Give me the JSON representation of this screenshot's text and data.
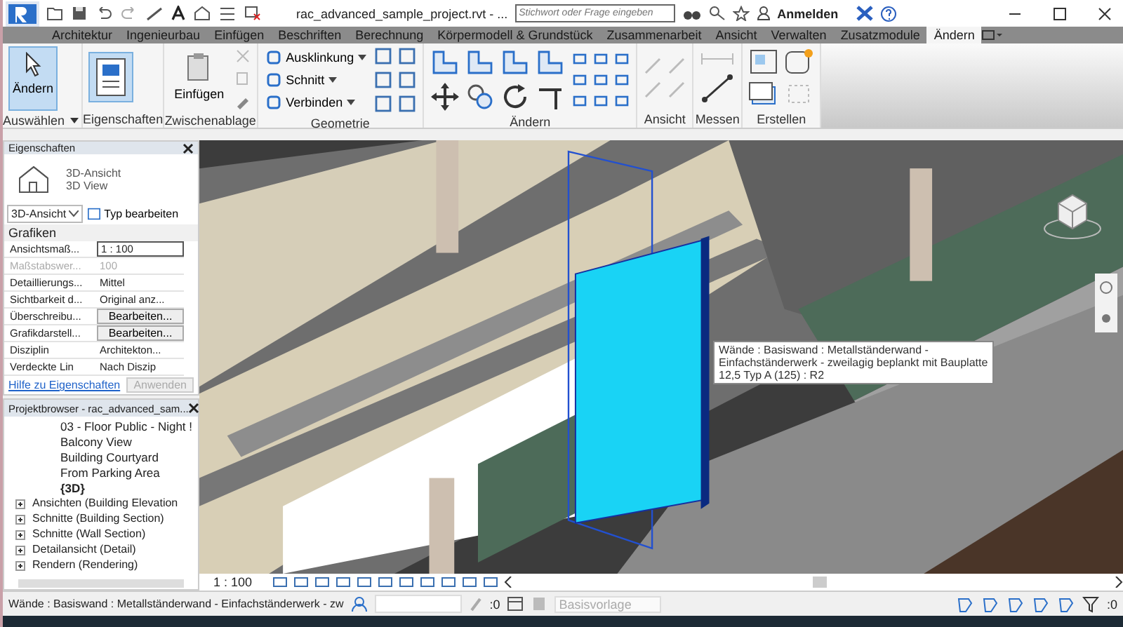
{
  "title_bar": {
    "title": "rac_advanced_sample_project.rvt - ...",
    "search_placeholder": "Stichwort oder Frage eingeben",
    "user": "Anmelden"
  },
  "tabs": [
    {
      "label": "Architektur",
      "selected": false
    },
    {
      "label": "Ingenieurbau",
      "selected": false
    },
    {
      "label": "Einfügen",
      "selected": false
    },
    {
      "label": "Beschriften",
      "selected": false
    },
    {
      "label": "Berechnung",
      "selected": false
    },
    {
      "label": "Körpermodell & Grundstück",
      "selected": false
    },
    {
      "label": "Zusammenarbeit",
      "selected": false
    },
    {
      "label": "Ansicht",
      "selected": false
    },
    {
      "label": "Verwalten",
      "selected": false
    },
    {
      "label": "Zusatzmodule",
      "selected": false
    },
    {
      "label": "Ändern",
      "selected": true
    }
  ],
  "ribbon": {
    "panels": [
      {
        "label": "Auswählen",
        "dropdown": true,
        "buttons": [
          {
            "label": "Ändern",
            "kind": "large",
            "active": true
          }
        ]
      },
      {
        "label": "Eigenschaften",
        "dropdown": false
      },
      {
        "label": "Zwischenablage",
        "dropdown": false,
        "buttons": [
          {
            "label": "Einfügen",
            "kind": "large",
            "active": false
          }
        ]
      },
      {
        "label": "Geometrie",
        "dropdown": false,
        "buttons": [
          {
            "label": "Ausklinkung",
            "kind": "small",
            "active": false
          },
          {
            "label": "Schnitt",
            "kind": "small",
            "active": false
          },
          {
            "label": "Verbinden",
            "kind": "small",
            "active": false
          }
        ]
      },
      {
        "label": "Ändern",
        "dropdown": false
      },
      {
        "label": "Ansicht",
        "dropdown": false
      },
      {
        "label": "Messen",
        "dropdown": false
      },
      {
        "label": "Erstellen",
        "dropdown": false
      }
    ]
  },
  "properties": {
    "title": "Eigenschaften",
    "type_name": "3D-Ansicht",
    "type_subname": "3D View",
    "type_selector": "3D-Ansicht",
    "edit_type": "Typ bearbeiten",
    "group": "Grafiken",
    "rows": [
      {
        "name": "Ansichtsmaß...",
        "value": "1 : 100",
        "kind": "input",
        "disabled": false
      },
      {
        "name": "Maßstabswer...",
        "value": "100",
        "kind": "text",
        "disabled": true
      },
      {
        "name": "Detaillierungs...",
        "value": "Mittel",
        "kind": "text",
        "disabled": false
      },
      {
        "name": "Sichtbarkeit d...",
        "value": "Original anz...",
        "kind": "text",
        "disabled": false
      },
      {
        "name": "Überschreibu...",
        "value": "Bearbeiten...",
        "kind": "button",
        "disabled": false
      },
      {
        "name": "Grafikdarstell...",
        "value": "Bearbeiten...",
        "kind": "button",
        "disabled": false
      },
      {
        "name": "Disziplin",
        "value": "Architekton...",
        "kind": "text",
        "disabled": false
      },
      {
        "name": "Verdeckte Lin",
        "value": "Nach Diszip",
        "kind": "text",
        "disabled": false
      }
    ],
    "help_link": "Hilfe zu Eigenschaften",
    "apply": {
      "label": "Anwenden",
      "disabled": true
    }
  },
  "project_browser": {
    "title": "Projektbrowser - rac_advanced_sam...",
    "nested_items": [
      {
        "label": "03 - Floor Public - Night !",
        "active": false
      },
      {
        "label": "Balcony View",
        "active": false
      },
      {
        "label": "Building Courtyard",
        "active": false
      },
      {
        "label": "From Parking Area",
        "active": false
      },
      {
        "label": "{3D}",
        "active": true
      }
    ],
    "items": [
      {
        "label": "Ansichten (Building Elevation",
        "expanded": false
      },
      {
        "label": "Schnitte (Building Section)",
        "expanded": false
      },
      {
        "label": "Schnitte (Wall Section)",
        "expanded": false
      },
      {
        "label": "Detailansicht (Detail)",
        "expanded": false
      },
      {
        "label": "Rendern (Rendering)",
        "expanded": false
      }
    ]
  },
  "tooltip": {
    "lines": [
      "Wände : Basiswand : Metallständerwand -",
      "Einfachständerwerk - zweilagig beplankt mit Bauplatte",
      "12,5 Typ A  (125) : R2"
    ]
  },
  "view_bar": {
    "scale": "1 : 100"
  },
  "status_bar": {
    "message": "Wände : Basiswand : Metallständerwand - Einfachständerwerk - zw",
    "worksets_count": ":0",
    "design_option": "Basisvorlage",
    "filter_count": ":0"
  }
}
